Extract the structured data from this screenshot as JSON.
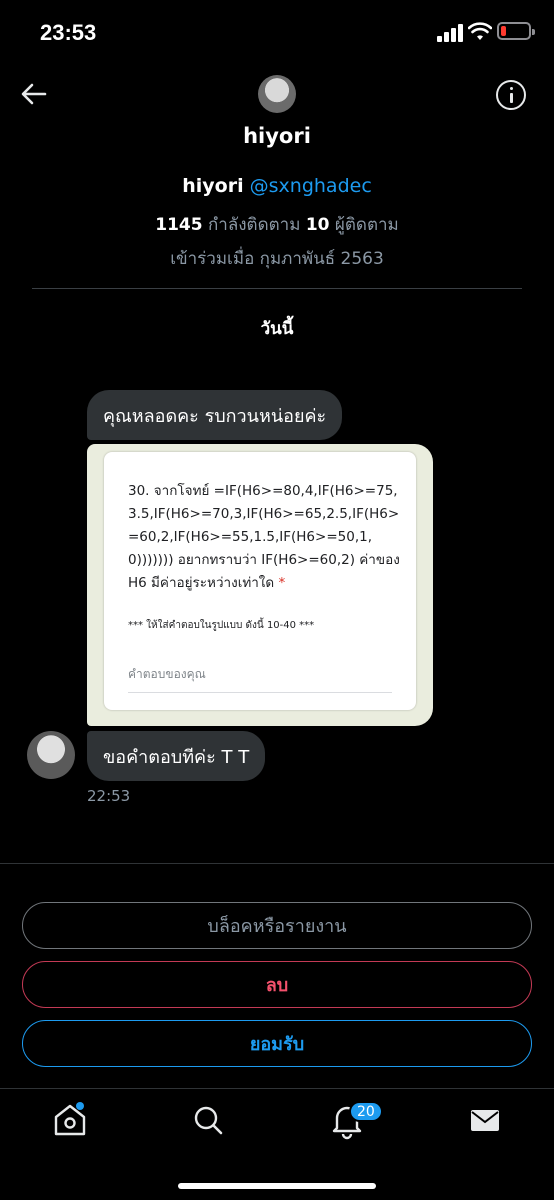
{
  "status_bar": {
    "time": "23:53"
  },
  "header": {
    "title": "hiyori"
  },
  "profile": {
    "name": "hiyori",
    "handle": "@sxnghadec",
    "following_count": "1145",
    "following_label": "กำลังติดตาม",
    "followers_count": "10",
    "followers_label": "ผู้ติดตาม",
    "joined": "เข้าร่วมเมื่อ กุมภาพันธ์ 2563"
  },
  "date_separator": "วันนี้",
  "messages": [
    {
      "text": "คุณหลอดคะ รบกวนหน่อยค่ะ"
    },
    {
      "image": {
        "question": "30. จากโจทย์ =IF(H6>=80,4,IF(H6>=75,3.5,IF(H6>=70,3,IF(H6>=65,2.5,IF(H6>=60,2,IF(H6>=55,1.5,IF(H6>=50,1,0))))))) อยากทราบว่า IF(H6>=60,2) ค่าของ H6 มีค่าอยู่ระหว่างเท่าใด",
        "required_mark": "*",
        "note": "*** ให้ใส่คำตอบในรูปแบบ ดังนี้ 10-40 ***",
        "answer_placeholder": "คำตอบของคุณ"
      }
    },
    {
      "text": "ขอคำตอบทีค่ะ T T"
    }
  ],
  "message_time": "22:53",
  "actions": {
    "block_report": "บล็อคหรือรายงาน",
    "delete": "ลบ",
    "accept": "ยอมรับ"
  },
  "tabbar": {
    "icons": [
      "home-icon",
      "search-icon",
      "bell-icon",
      "mail-icon"
    ],
    "notifications_badge": "20"
  },
  "colors": {
    "accent": "#1d9bf0",
    "danger": "#f4516c",
    "bubble": "#2f3336",
    "background": "#000000"
  }
}
